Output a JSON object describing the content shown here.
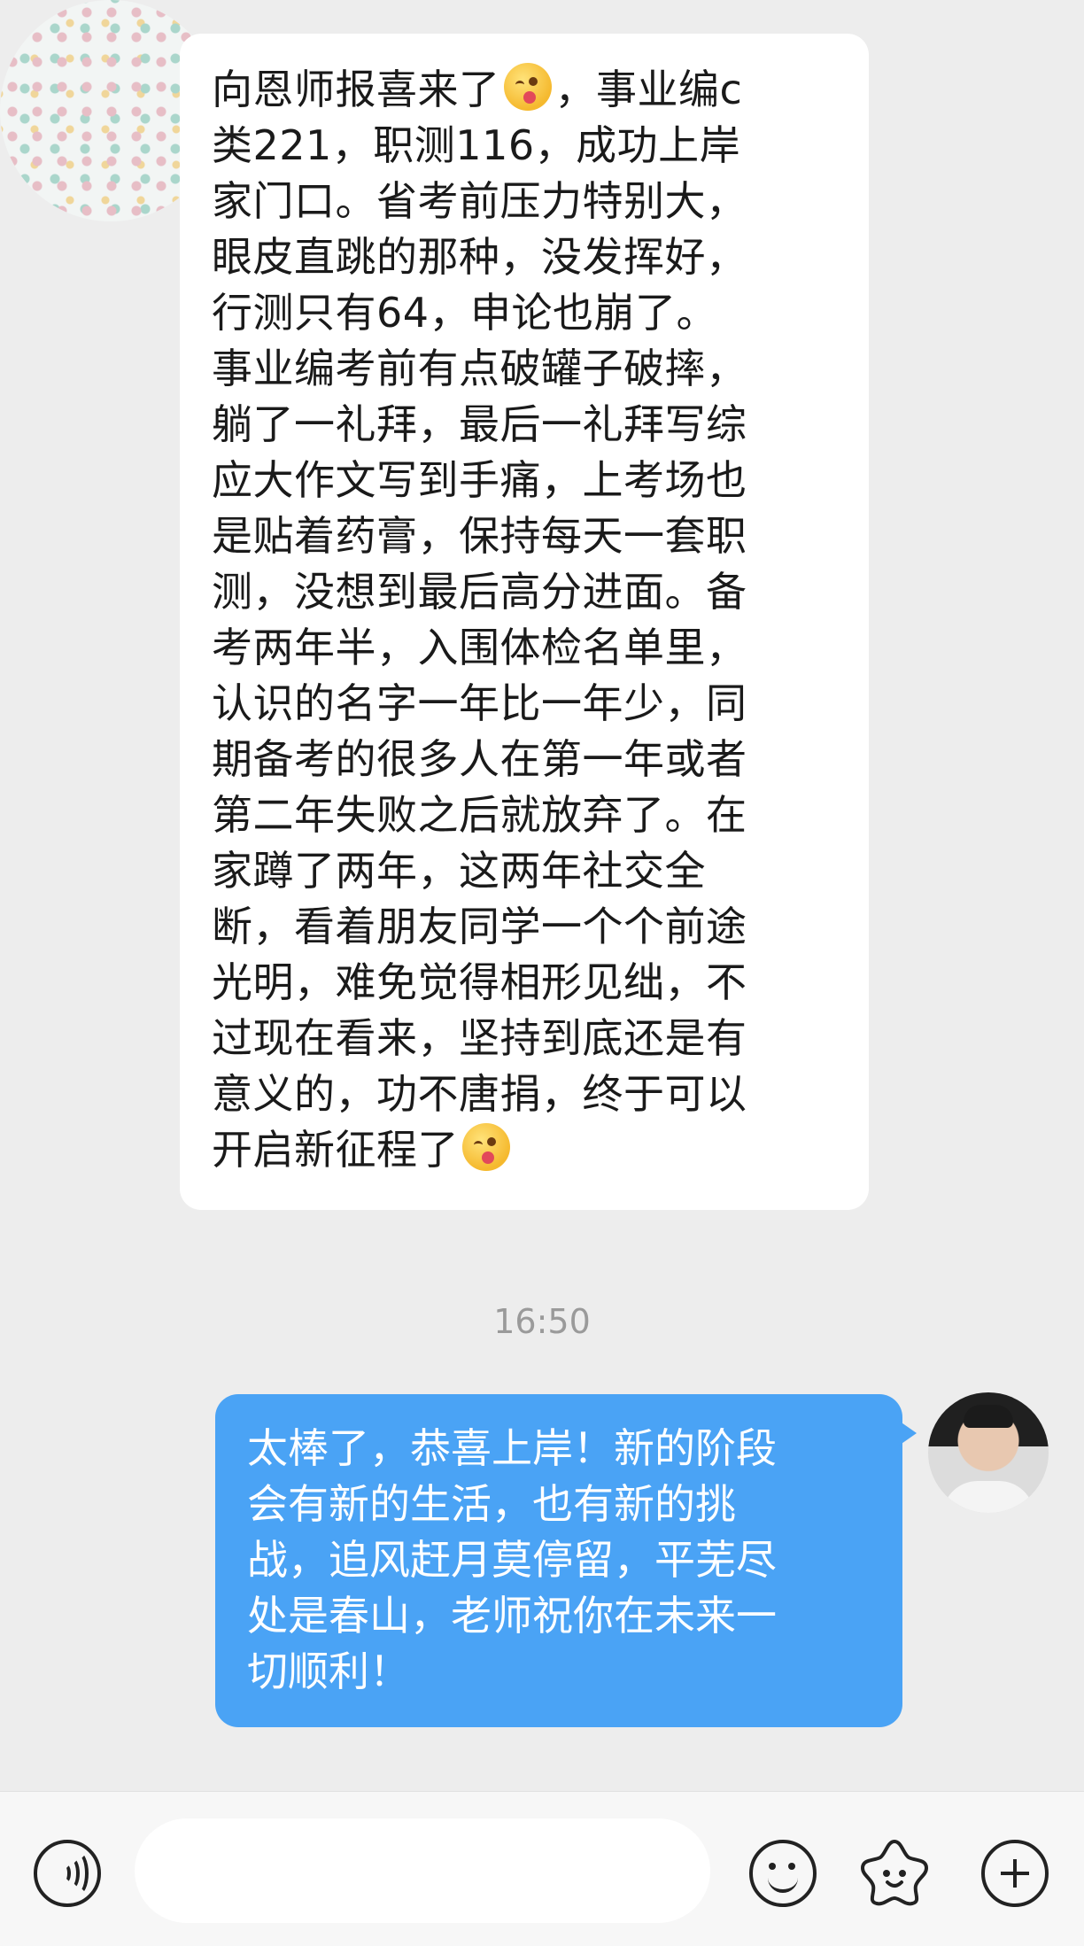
{
  "incoming_message": {
    "lines": [
      "向恩师报喜来了",
      "类221，职测116，成功上岸",
      "家门口。省考前压力特别大，",
      "眼皮直跳的那种，没发挥好，",
      "行测只有64，申论也崩了。",
      "事业编考前有点破罐子破摔，",
      "躺了一礼拜，最后一礼拜写综",
      "应大作文写到手痛，上考场也",
      "是贴着药膏，保持每天一套职",
      "测，没想到最后高分进面。备",
      "考两年半，入围体检名单里，",
      "认识的名字一年比一年少，同",
      "期备考的很多人在第一年或者",
      "第二年失败之后就放弃了。在",
      "家蹲了两年，这两年社交全",
      "断，看着朋友同学一个个前途",
      "光明，难免觉得相形见绌，不",
      "过现在看来，坚持到底还是有",
      "意义的，功不唐捐，终于可以",
      "开启新征程了"
    ],
    "line1_suffix": "，事业编c",
    "emoji": "smile-blush-emoji"
  },
  "timestamp": "16:50",
  "outgoing_message": {
    "lines": [
      "太棒了，恭喜上岸！新的阶段",
      "会有新的生活，也有新的挑",
      "战，追风赶月莫停留，平芜尽",
      "处是春山，老师祝你在未来一",
      "切顺利！"
    ]
  },
  "input_bar": {
    "placeholder": "",
    "icons": [
      "voice-icon",
      "emoji-icon",
      "sticker-icon",
      "plus-icon"
    ]
  },
  "colors": {
    "background": "#ededed",
    "incoming_bubble": "#ffffff",
    "outgoing_bubble": "#4aa3f5"
  }
}
